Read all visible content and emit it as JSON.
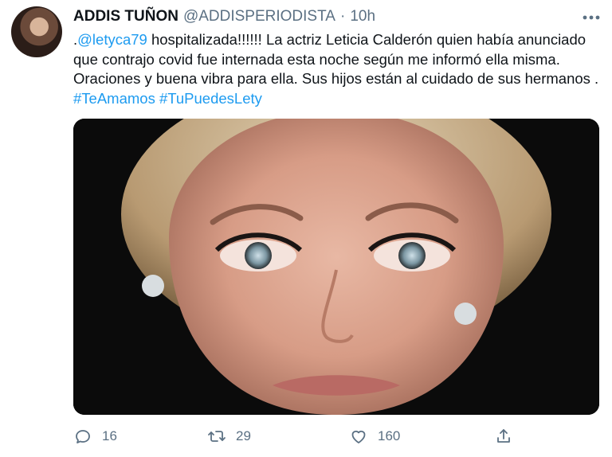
{
  "tweet": {
    "author_name": "ADDIS TUÑON",
    "handle": "@ADDISPERIODISTA",
    "separator": "·",
    "time": "10h",
    "mention": "@letyca79",
    "body_part1": " hospitalizada!!!!!!  La actriz Leticia Calderón quien había anunciado que contrajo covid fue internada esta noche según me informó ella misma. Oraciones y buena vibra para ella. Sus hijos están al cuidado de sus hermanos . ",
    "hashtag1": "#TeAmamos",
    "hashtag2": "#TuPuedesLety",
    "leading_dot": "."
  },
  "actions": {
    "reply_count": "16",
    "retweet_count": "29",
    "like_count": "160"
  },
  "icons": {
    "more": "more-horizontal-icon",
    "reply": "reply-icon",
    "retweet": "retweet-icon",
    "like": "heart-icon",
    "share": "share-icon"
  },
  "colors": {
    "link": "#1d9bf0",
    "secondary_text": "#5b7083",
    "primary_text": "#0f1419"
  }
}
